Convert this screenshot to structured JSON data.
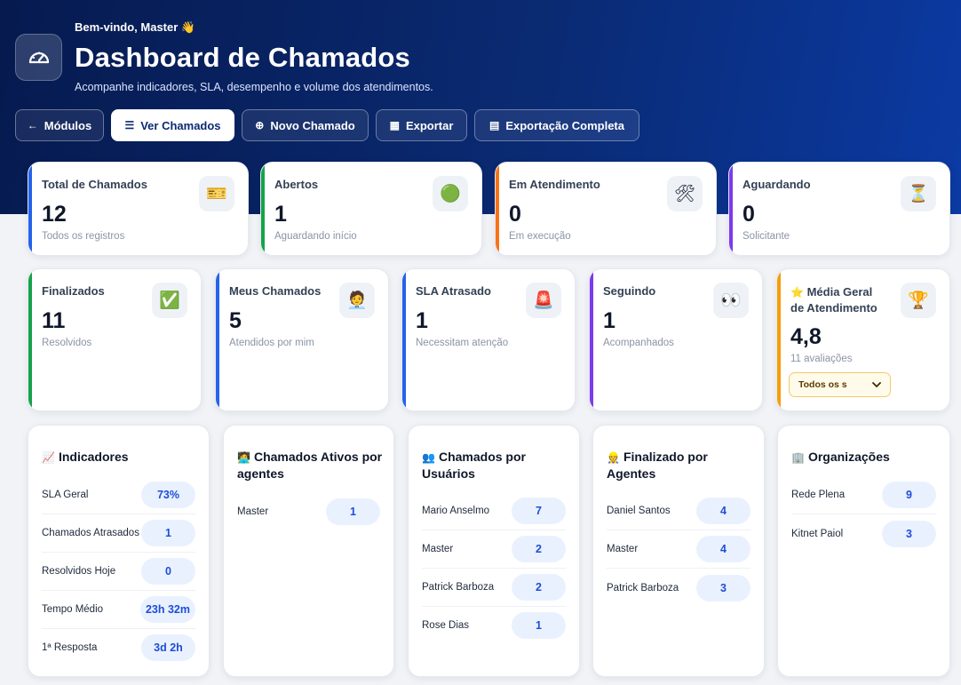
{
  "header": {
    "welcome": "Bem-vindo, Master 👋",
    "title": "Dashboard de Chamados",
    "subtitle": "Acompanhe indicadores, SLA, desempenho e volume dos atendimentos."
  },
  "toolbar": [
    {
      "label": "Módulos",
      "icon": "←"
    },
    {
      "label": "Ver Chamados",
      "icon": "☰"
    },
    {
      "label": "Novo Chamado",
      "icon": "⊕"
    },
    {
      "label": "Exportar",
      "icon": "▦"
    },
    {
      "label": "Exportação Completa",
      "icon": "▤"
    }
  ],
  "stats_row1": [
    {
      "label": "Total de Chamados",
      "value": "12",
      "sub": "Todos os registros",
      "emoji": "🎫",
      "color": "#2563eb"
    },
    {
      "label": "Abertos",
      "value": "1",
      "sub": "Aguardando início",
      "emoji": "🟢",
      "color": "#16a34a"
    },
    {
      "label": "Em Atendimento",
      "value": "0",
      "sub": "Em execução",
      "emoji": "🛠",
      "color": "#f97316"
    },
    {
      "label": "Aguardando",
      "value": "0",
      "sub": "Solicitante",
      "emoji": "⏳",
      "color": "#7c3aed"
    }
  ],
  "stats_row2": [
    {
      "label": "Finalizados",
      "value": "11",
      "sub": "Resolvidos",
      "emoji": "✅",
      "color": "#16a34a"
    },
    {
      "label": "Meus Chamados",
      "value": "5",
      "sub": "Atendidos por mim",
      "emoji": "🧑‍💼",
      "color": "#2563eb"
    },
    {
      "label": "SLA Atrasado",
      "value": "1",
      "sub": "Necessitam atenção",
      "emoji": "🚨",
      "color": "#2563eb"
    },
    {
      "label": "Seguindo",
      "value": "1",
      "sub": "Acompanhados",
      "emoji": "👀",
      "color": "#7c3aed"
    }
  ],
  "rating": {
    "star": "⭐",
    "label_line1": "Média Geral",
    "label_line2": "de Atendimento",
    "value": "4,8",
    "sub": "11 avaliações",
    "emoji": "🏆",
    "color": "#f59e0b",
    "select_value": "Todos os s"
  },
  "panels": {
    "indicadores": {
      "emoji": "📈",
      "title": "Indicadores",
      "rows": [
        {
          "name": "SLA Geral",
          "value": "73%"
        },
        {
          "name": "Chamados Atrasados",
          "value": "1"
        },
        {
          "name": "Resolvidos Hoje",
          "value": "0"
        },
        {
          "name": "Tempo Médio",
          "value": "23h 32m"
        },
        {
          "name": "1ª Resposta",
          "value": "3d 2h"
        }
      ]
    },
    "ativos": {
      "emoji": "🧑‍💻",
      "title": "Chamados Ativos por agentes",
      "rows": [
        {
          "name": "Master",
          "value": "1"
        }
      ]
    },
    "usuarios": {
      "emoji": "👥",
      "title": "Chamados por Usuários",
      "rows": [
        {
          "name": "Mario Anselmo",
          "value": "7"
        },
        {
          "name": "Master",
          "value": "2"
        },
        {
          "name": "Patrick Barboza",
          "value": "2"
        },
        {
          "name": "Rose Dias",
          "value": "1"
        }
      ]
    },
    "finalizado": {
      "emoji": "👷",
      "title": "Finalizado por Agentes",
      "rows": [
        {
          "name": "Daniel Santos",
          "value": "4"
        },
        {
          "name": "Master",
          "value": "4"
        },
        {
          "name": "Patrick Barboza",
          "value": "3"
        }
      ]
    },
    "organizacoes": {
      "emoji": "🏢",
      "title": "Organizações",
      "rows": [
        {
          "name": "Rede Plena",
          "value": "9"
        },
        {
          "name": "Kitnet Paiol",
          "value": "3"
        }
      ]
    }
  }
}
